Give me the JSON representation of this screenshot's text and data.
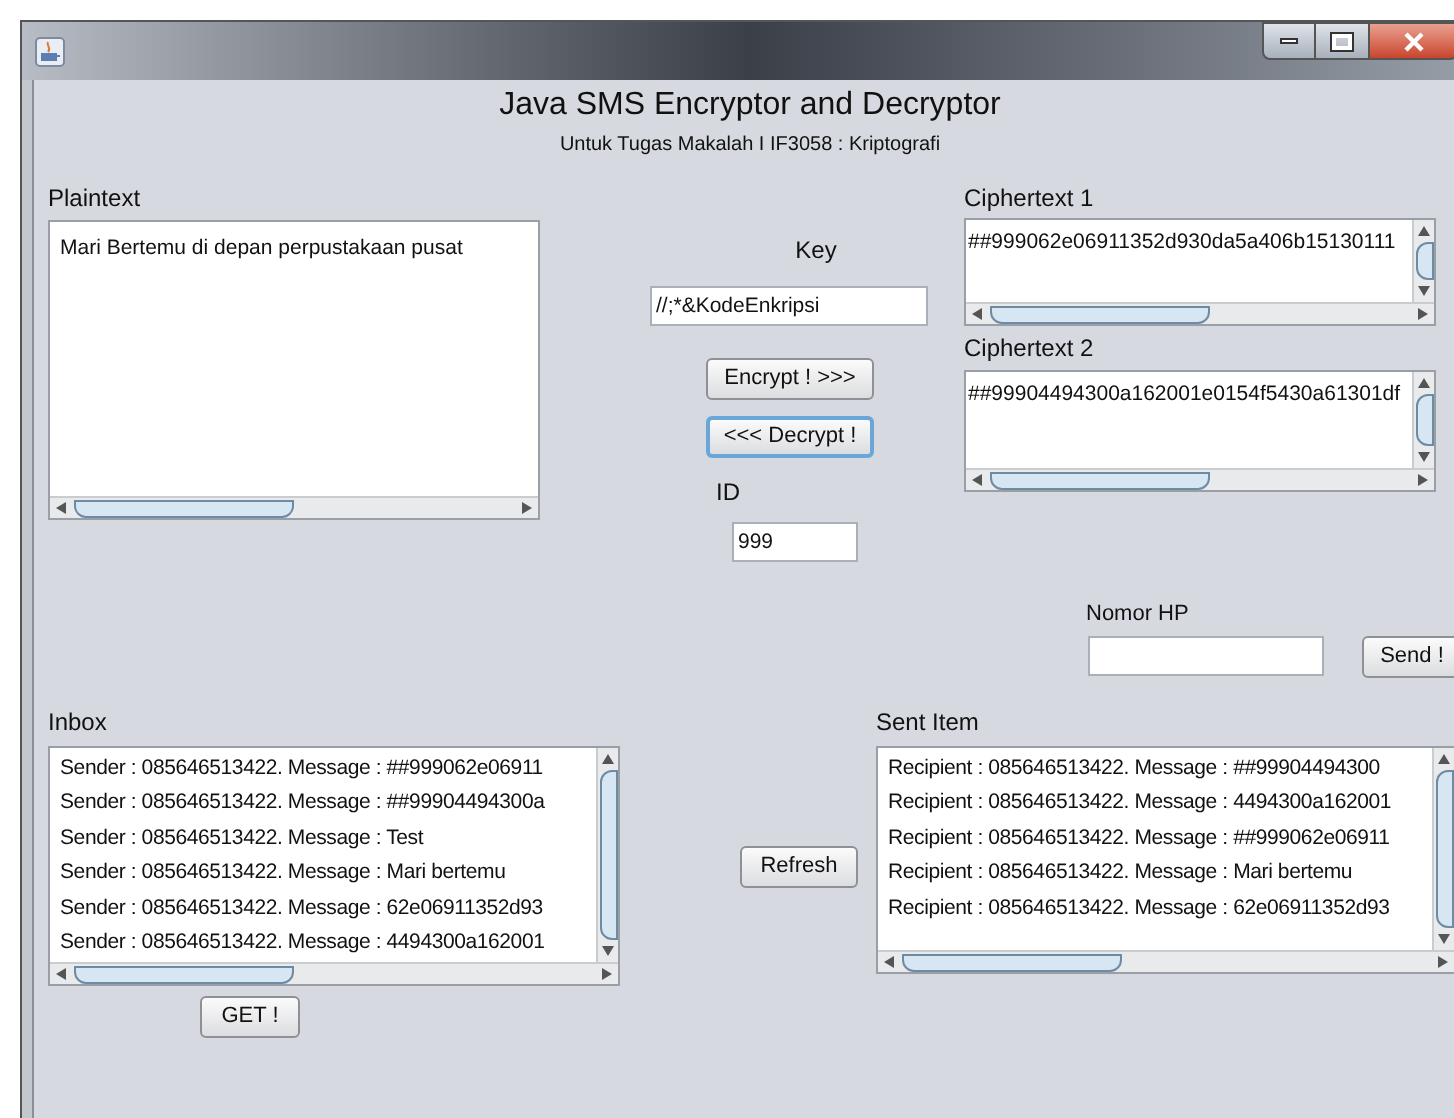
{
  "header": {
    "title": "Java SMS Encryptor and Decryptor",
    "subtitle": "Untuk Tugas Makalah I IF3058 : Kriptografi"
  },
  "plaintext": {
    "label": "Plaintext",
    "value": "Mari Bertemu di depan perpustakaan pusat"
  },
  "key": {
    "label": "Key",
    "value": "//;*&KodeEnkripsi"
  },
  "actions": [
    {
      "label": "Encrypt ! >>>",
      "focused": false
    },
    {
      "label": "<<< Decrypt !",
      "focused": true
    }
  ],
  "id": {
    "label": "ID",
    "value": "999"
  },
  "ciphertext_1": {
    "label": "Ciphertext 1",
    "value": "##999062e06911352d930da5a406b15130111"
  },
  "ciphertext_2": {
    "label": "Ciphertext 2",
    "value": "##99904494300a162001e0154f5430a61301df"
  },
  "phone": {
    "label": "Nomor HP",
    "send_button": "Send !"
  },
  "inbox": {
    "label": "Inbox",
    "items": [
      "Sender : 085646513422. Message : ##999062e06911",
      "Sender : 085646513422. Message : ##99904494300a",
      "Sender : 085646513422. Message : Test",
      "Sender : 085646513422. Message : Mari bertemu",
      "Sender : 085646513422. Message : 62e06911352d93",
      "Sender : 085646513422. Message : 4494300a162001"
    ],
    "get_button": "GET !"
  },
  "refresh_button": "Refresh",
  "sent": {
    "label": "Sent Item",
    "items": [
      "Recipient : 085646513422. Message : ##99904494300",
      "Recipient : 085646513422. Message : 4494300a162001",
      "Recipient : 085646513422. Message : ##999062e06911",
      "Recipient : 085646513422. Message : Mari bertemu",
      "Recipient : 085646513422. Message : 62e06911352d93"
    ]
  }
}
